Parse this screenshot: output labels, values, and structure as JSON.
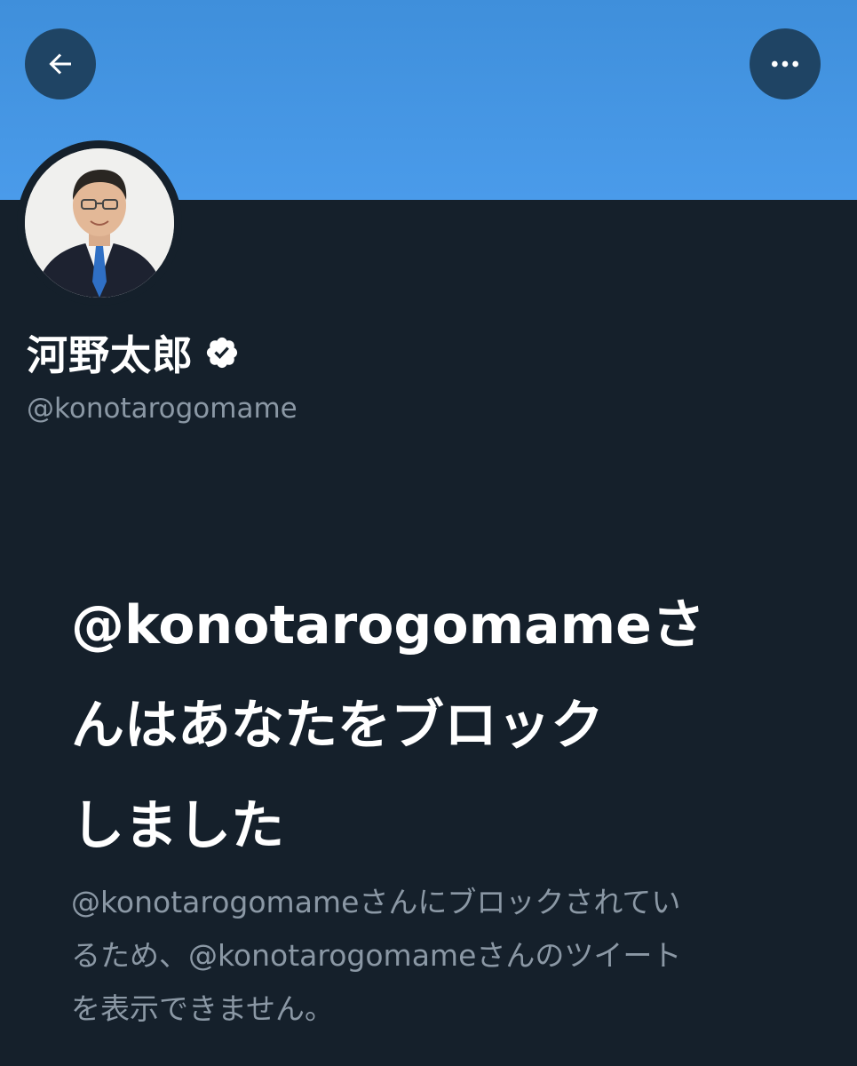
{
  "header": {
    "back_icon": "arrow-left-icon",
    "more_icon": "more-horizontal-icon",
    "banner_color": "#4a9bea"
  },
  "profile": {
    "display_name": "河野太郎",
    "verified_icon": "verified-badge-icon",
    "handle": "@konotarogomame"
  },
  "block_notice": {
    "title_lines": [
      "@konotarogomameさ",
      "んはあなたをブロック",
      "しました"
    ],
    "description_lines": [
      "@konotarogomameさんにブロックされてい",
      "るため、@konotarogomameさんのツイート",
      "を表示できません。"
    ]
  },
  "colors": {
    "background": "#15202b",
    "secondary_text": "#8b98a5",
    "button_bg": "#1f4464"
  }
}
